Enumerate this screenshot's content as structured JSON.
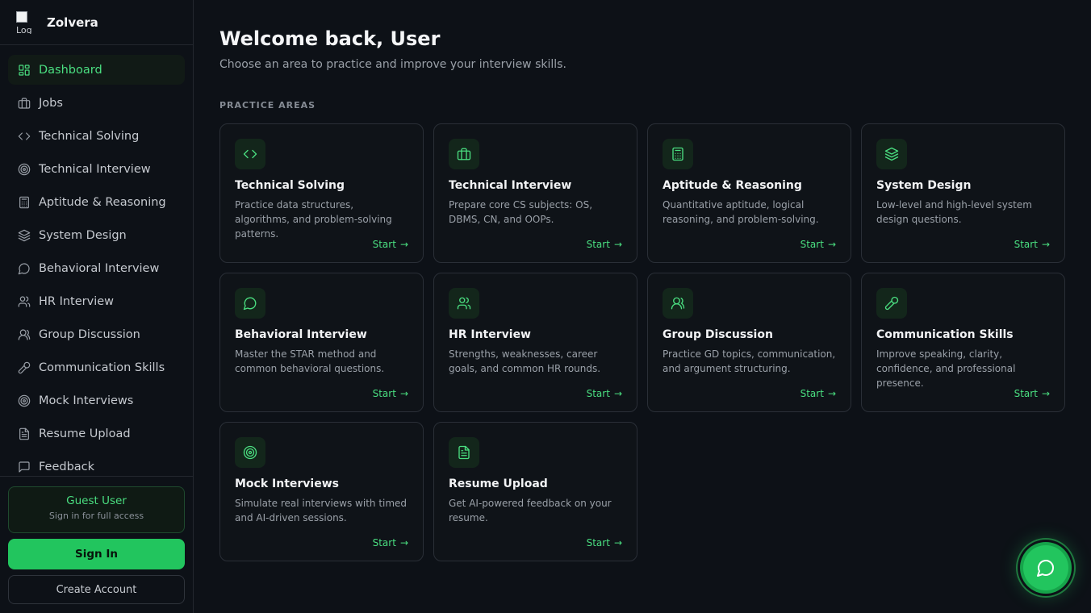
{
  "brand": {
    "name": "Zolvera",
    "logo_alt": "Log"
  },
  "sidebar": {
    "items": [
      {
        "label": "Dashboard",
        "icon": "dashboard-icon",
        "active": true
      },
      {
        "label": "Jobs",
        "icon": "briefcase-icon"
      },
      {
        "label": "Technical Solving",
        "icon": "code-icon"
      },
      {
        "label": "Technical Interview",
        "icon": "target-icon"
      },
      {
        "label": "Aptitude & Reasoning",
        "icon": "calculator-icon"
      },
      {
        "label": "System Design",
        "icon": "layers-icon"
      },
      {
        "label": "Behavioral Interview",
        "icon": "chat-bubble-icon"
      },
      {
        "label": "HR Interview",
        "icon": "users-icon"
      },
      {
        "label": "Group Discussion",
        "icon": "group-icon"
      },
      {
        "label": "Communication Skills",
        "icon": "microphone-icon"
      },
      {
        "label": "Mock Interviews",
        "icon": "target-icon"
      },
      {
        "label": "Resume Upload",
        "icon": "document-icon"
      },
      {
        "label": "Feedback",
        "icon": "message-square-icon"
      }
    ],
    "guest": {
      "title": "Guest User",
      "subtitle": "Sign in for full access"
    },
    "sign_in_label": "Sign In",
    "create_account_label": "Create Account"
  },
  "main": {
    "title": "Welcome back, User",
    "subtitle": "Choose an area to practice and improve your interview skills.",
    "section_label": "PRACTICE AREAS",
    "start_label": "Start",
    "cards": [
      {
        "title": "Technical Solving",
        "desc": "Practice data structures, algorithms, and problem-solving patterns.",
        "icon": "code-icon"
      },
      {
        "title": "Technical Interview",
        "desc": "Prepare core CS subjects: OS, DBMS, CN, and OOPs.",
        "icon": "briefcase-icon"
      },
      {
        "title": "Aptitude & Reasoning",
        "desc": "Quantitative aptitude, logical reasoning, and problem-solving.",
        "icon": "calculator-icon"
      },
      {
        "title": "System Design",
        "desc": "Low-level and high-level system design questions.",
        "icon": "layers-icon"
      },
      {
        "title": "Behavioral Interview",
        "desc": "Master the STAR method and common behavioral questions.",
        "icon": "chat-bubble-icon"
      },
      {
        "title": "HR Interview",
        "desc": "Strengths, weaknesses, career goals, and common HR rounds.",
        "icon": "users-icon"
      },
      {
        "title": "Group Discussion",
        "desc": "Practice GD topics, communication, and argument structuring.",
        "icon": "group-icon"
      },
      {
        "title": "Communication Skills",
        "desc": "Improve speaking, clarity, confidence, and professional presence.",
        "icon": "microphone-icon"
      },
      {
        "title": "Mock Interviews",
        "desc": "Simulate real interviews with timed and AI-driven sessions.",
        "icon": "target-icon"
      },
      {
        "title": "Resume Upload",
        "desc": "Get AI-powered feedback on your resume.",
        "icon": "document-icon"
      }
    ]
  },
  "colors": {
    "accent": "#22c55e",
    "accent_text": "#4ade80",
    "background": "#0d1117"
  }
}
